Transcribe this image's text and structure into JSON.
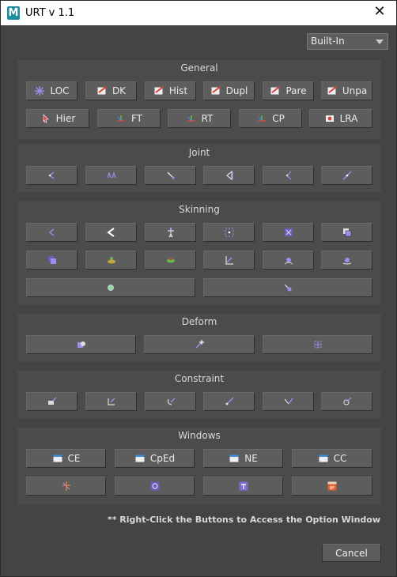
{
  "window": {
    "logo": "M",
    "title": "URT v 1.1",
    "close_glyph": "✕"
  },
  "preset": {
    "value": "Built-In"
  },
  "sections": {
    "general": {
      "title": "General",
      "buttons": [
        {
          "label": "LOC",
          "icon": "locator-icon"
        },
        {
          "label": "DK",
          "icon": "delete-keys-icon"
        },
        {
          "label": "Hist",
          "icon": "history-icon"
        },
        {
          "label": "Dupl",
          "icon": "duplicate-icon"
        },
        {
          "label": "Pare",
          "icon": "parent-icon"
        },
        {
          "label": "Unpa",
          "icon": "unparent-icon"
        },
        {
          "label": "Hier",
          "icon": "hierarchy-icon"
        },
        {
          "label": "FT",
          "icon": "freeze-transform-icon"
        },
        {
          "label": "RT",
          "icon": "reset-transform-icon"
        },
        {
          "label": "CP",
          "icon": "center-pivot-icon"
        },
        {
          "label": "LRA",
          "icon": "local-rotation-axes-icon"
        }
      ]
    },
    "joint": {
      "title": "Joint",
      "icons": [
        "joint-tool-icon",
        "mirror-joint-icon",
        "insert-joint-icon",
        "orient-joint-icon",
        "joint-chain-icon",
        "ik-handle-icon"
      ]
    },
    "skinning": {
      "title": "Skinning",
      "icons": [
        "bind-skin-icon",
        "unbind-skin-icon",
        "paint-weights-icon",
        "smooth-bind-icon",
        "component-editor-icon",
        "copy-weights-icon",
        "mirror-weights-icon",
        "add-influence-icon",
        "remove-influence-icon",
        "weight-hammer-icon",
        "prune-weights-icon",
        "reset-bind-pose-icon",
        "go-to-bind-pose-icon",
        "skin-cluster-icon"
      ]
    },
    "deform": {
      "title": "Deform",
      "icons": [
        "blend-shape-icon",
        "cluster-icon",
        "lattice-icon"
      ]
    },
    "constraint": {
      "title": "Constraint",
      "icons": [
        "point-constraint-icon",
        "orient-constraint-icon",
        "parent-constraint-icon",
        "scale-constraint-icon",
        "aim-constraint-icon",
        "pole-vector-icon"
      ]
    },
    "windows": {
      "title": "Windows",
      "buttons": [
        {
          "label": "CE",
          "icon": "connection-editor-icon"
        },
        {
          "label": "CpEd",
          "icon": "component-editor-window-icon"
        },
        {
          "label": "NE",
          "icon": "node-editor-icon"
        },
        {
          "label": "CC",
          "icon": "channel-control-icon"
        }
      ],
      "icons": [
        "outliner-icon",
        "hypershade-icon",
        "set-driven-key-icon",
        "script-editor-icon"
      ]
    }
  },
  "hint": "** Right-Click the Buttons to Access the Option Window",
  "cancel_label": "Cancel",
  "colors": {
    "window_bg": "#444444",
    "section_bg": "#4b4b4b",
    "button_bg": "#5d5d5d",
    "accent_purple": "#9a8ef0",
    "accent_red": "#e0403a",
    "accent_green": "#5fbf4a"
  }
}
